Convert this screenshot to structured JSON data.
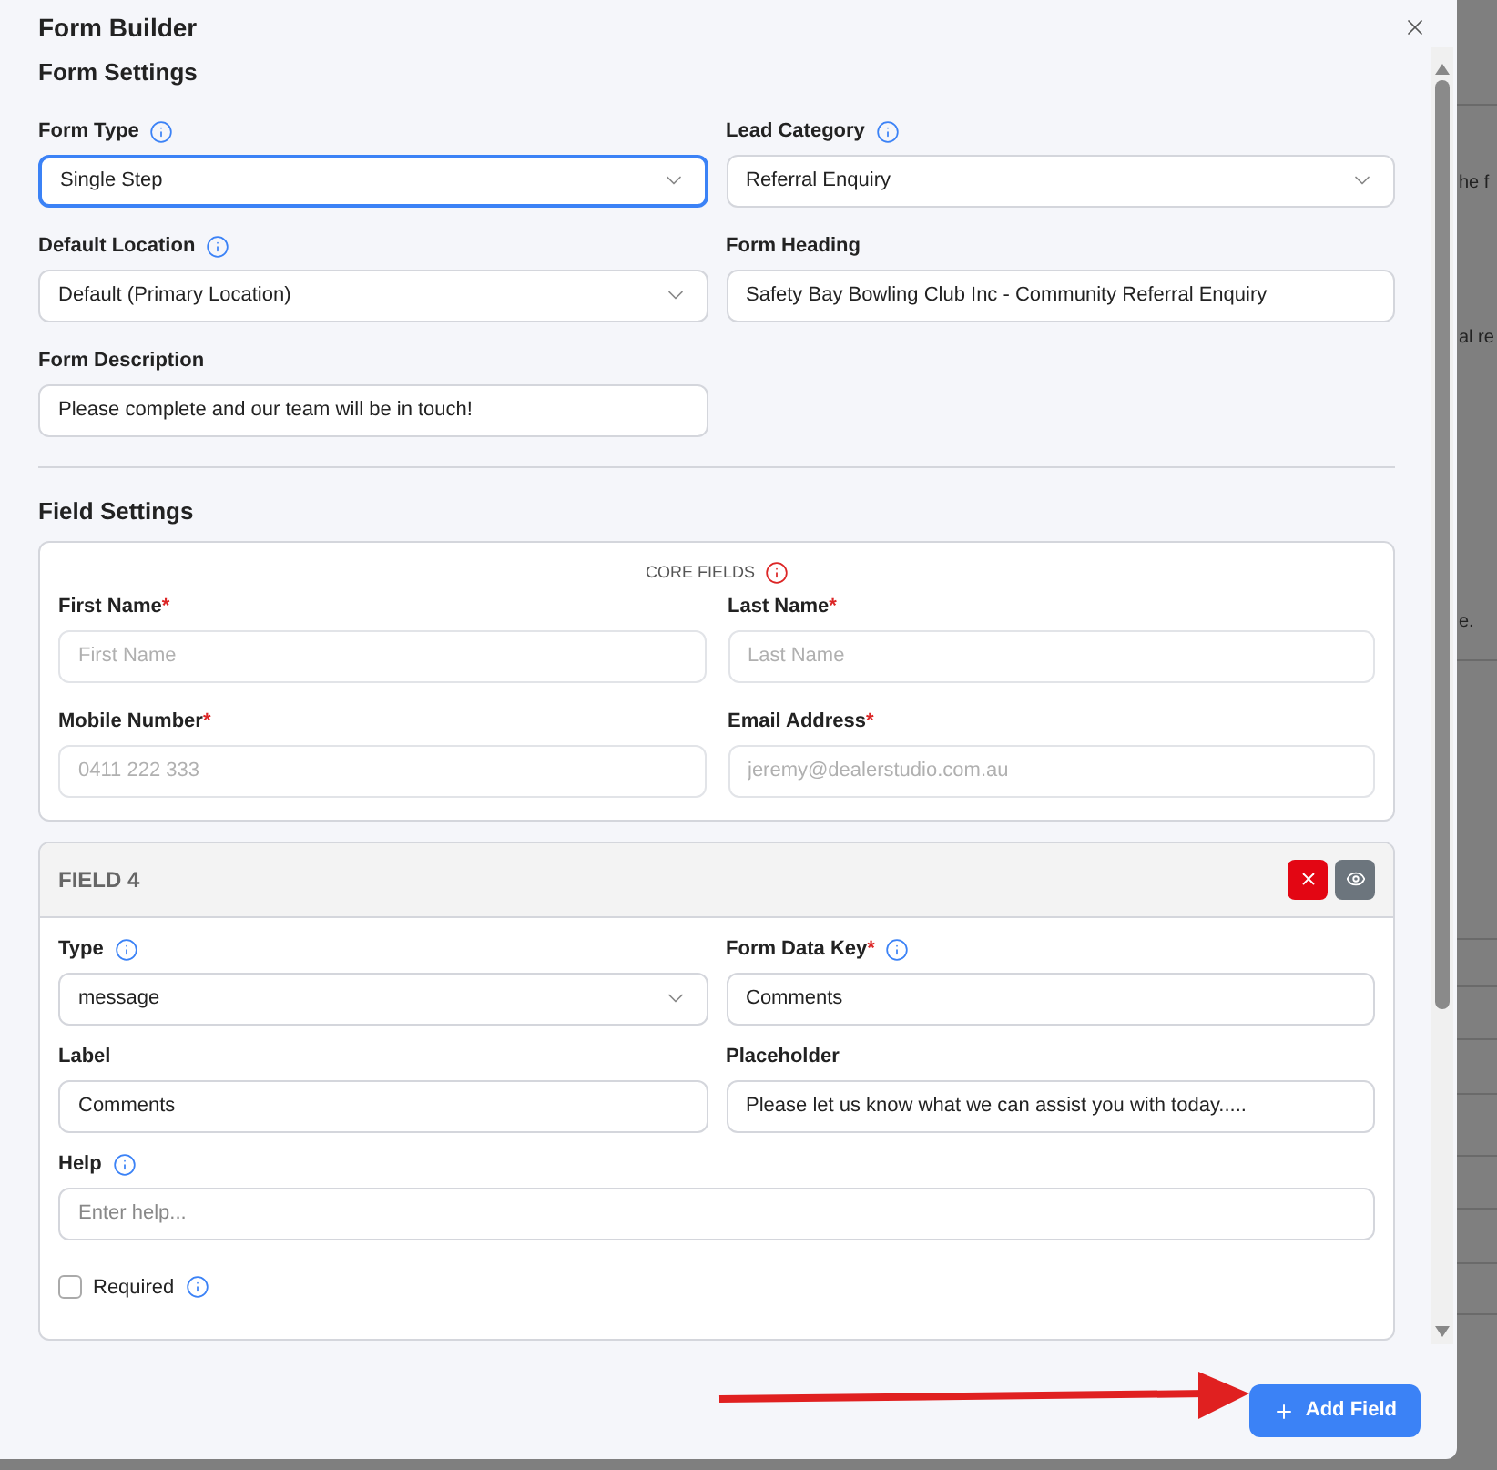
{
  "modal": {
    "title": "Form Builder"
  },
  "form_settings": {
    "heading": "Form Settings",
    "fields": [
      {
        "kind": "select",
        "label": "Form Type",
        "info": true,
        "value": "Single Step",
        "focused": true
      },
      {
        "kind": "select",
        "label": "Lead Category",
        "info": true,
        "value": "Referral Enquiry",
        "focused": false
      },
      {
        "kind": "select",
        "label": "Default Location",
        "info": true,
        "value": "Default (Primary Location)",
        "focused": false
      },
      {
        "kind": "text",
        "label": "Form Heading",
        "value": "Safety Bay Bowling Club Inc - Community Referral Enquiry",
        "focused": false
      },
      {
        "kind": "text",
        "label": "Form Description",
        "value": "Please complete and our team will be in touch!",
        "focused": false
      }
    ]
  },
  "field_settings": {
    "heading": "Field Settings",
    "core": {
      "title": "CORE FIELDS",
      "fields": [
        {
          "label": "First Name",
          "required_mark": "*",
          "placeholder": "First Name"
        },
        {
          "label": "Last Name",
          "required_mark": "*",
          "placeholder": "Last Name"
        },
        {
          "label": "Mobile Number",
          "required_mark": "*",
          "placeholder": "0411 222 333"
        },
        {
          "label": "Email Address",
          "required_mark": "*",
          "placeholder": "jeremy@dealerstudio.com.au"
        }
      ]
    },
    "field_card": {
      "title": "FIELD 4",
      "fields": [
        {
          "kind": "select",
          "label": "Type",
          "info": true,
          "value": "message"
        },
        {
          "kind": "text",
          "label": "Form Data Key",
          "info": true,
          "required_mark": "*",
          "value": "Comments"
        },
        {
          "kind": "text",
          "label": "Label",
          "value": "Comments"
        },
        {
          "kind": "text",
          "label": "Placeholder",
          "value": "Please let us know what we can assist you with today....."
        }
      ],
      "help": {
        "label": "Help",
        "info": true,
        "placeholder": "Enter help..."
      },
      "required_checkbox": {
        "label": "Required",
        "checked": false,
        "info": true
      }
    }
  },
  "footer": {
    "button": "Add Field"
  },
  "background": {
    "fragments": [
      "he f",
      "al re",
      "e."
    ]
  }
}
